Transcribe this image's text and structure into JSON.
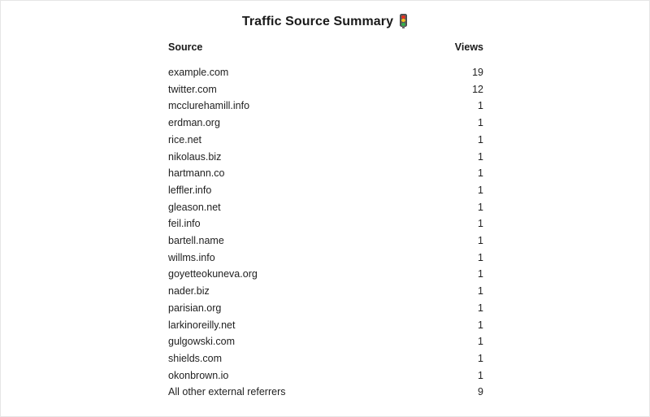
{
  "report": {
    "title": "Traffic Source Summary",
    "title_icon": "traffic-light-icon",
    "title_emoji": "🚦"
  },
  "table": {
    "columns": [
      {
        "key": "source",
        "label": "Source",
        "align": "left"
      },
      {
        "key": "views",
        "label": "Views",
        "align": "right"
      }
    ],
    "rows": [
      {
        "source": "example.com",
        "views": "19"
      },
      {
        "source": "twitter.com",
        "views": "12"
      },
      {
        "source": "mcclurehamill.info",
        "views": "1"
      },
      {
        "source": "erdman.org",
        "views": "1"
      },
      {
        "source": "rice.net",
        "views": "1"
      },
      {
        "source": "nikolaus.biz",
        "views": "1"
      },
      {
        "source": "hartmann.co",
        "views": "1"
      },
      {
        "source": "leffler.info",
        "views": "1"
      },
      {
        "source": "gleason.net",
        "views": "1"
      },
      {
        "source": "feil.info",
        "views": "1"
      },
      {
        "source": "bartell.name",
        "views": "1"
      },
      {
        "source": "willms.info",
        "views": "1"
      },
      {
        "source": "goyetteokuneva.org",
        "views": "1"
      },
      {
        "source": "nader.biz",
        "views": "1"
      },
      {
        "source": "parisian.org",
        "views": "1"
      },
      {
        "source": "larkinoreilly.net",
        "views": "1"
      },
      {
        "source": "gulgowski.com",
        "views": "1"
      },
      {
        "source": "shields.com",
        "views": "1"
      },
      {
        "source": "okonbrown.io",
        "views": "1"
      },
      {
        "source": "All other external referrers",
        "views": "9"
      }
    ]
  },
  "colors": {
    "text": "#1a1a1a",
    "background": "#ffffff",
    "border": "#e6e6e6",
    "light_red": "#e8301f",
    "light_yellow": "#f4c020",
    "light_green": "#33b14c"
  }
}
